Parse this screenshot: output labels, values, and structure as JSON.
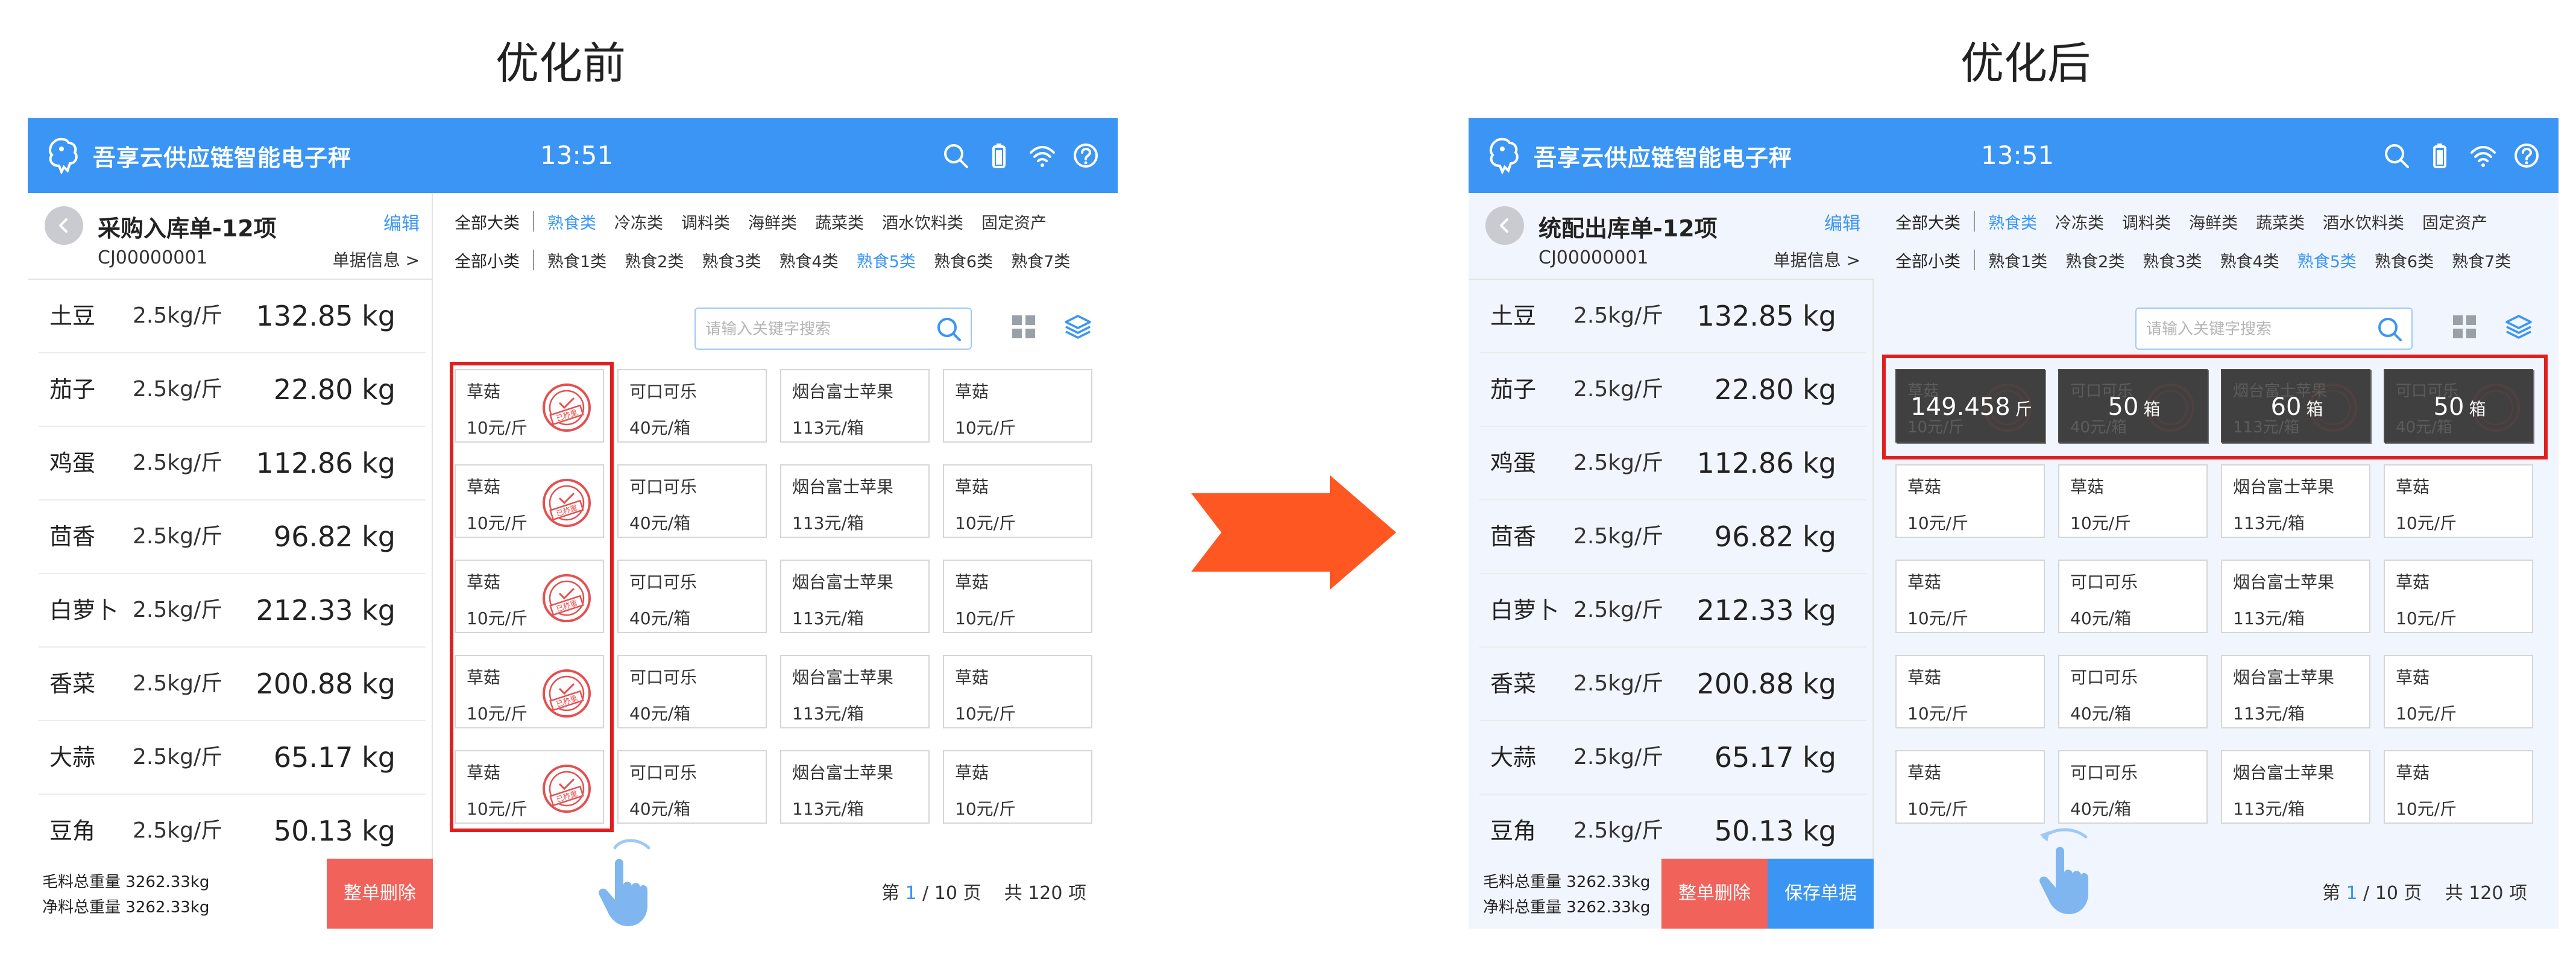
{
  "labels": {
    "before": "优化前",
    "after": "优化后"
  },
  "app": {
    "name": "吾享云供应链智能电子秤",
    "time": "13:51"
  },
  "colors": {
    "primary": "#3b95f4",
    "danger": "#f0625a",
    "highlight": "#e02020",
    "arrow": "#ff5722"
  },
  "icons": [
    "search-icon",
    "battery-icon",
    "wifi-icon",
    "help-icon",
    "back-icon",
    "grid-view-icon",
    "layers-icon",
    "stamp-icon",
    "hand-swipe-icon",
    "arrow-right-icon"
  ],
  "filters": {
    "major_label": "全部大类",
    "major": [
      "熟食类",
      "冷冻类",
      "调料类",
      "海鲜类",
      "蔬菜类",
      "酒水饮料类",
      "固定资产"
    ],
    "major_active": 0,
    "minor_label": "全部小类",
    "minor": [
      "熟食1类",
      "熟食2类",
      "熟食3类",
      "熟食4类",
      "熟食5类",
      "熟食6类",
      "熟食7类"
    ],
    "minor_active": 4
  },
  "search": {
    "placeholder": "请输入关键字搜索"
  },
  "items": [
    {
      "name": "土豆",
      "unit": "2.5kg/斤",
      "weight": "132.85 kg"
    },
    {
      "name": "茄子",
      "unit": "2.5kg/斤",
      "weight": "22.80 kg"
    },
    {
      "name": "鸡蛋",
      "unit": "2.5kg/斤",
      "weight": "112.86 kg"
    },
    {
      "name": "茴香",
      "unit": "2.5kg/斤",
      "weight": "96.82 kg"
    },
    {
      "name": "白萝卜",
      "unit": "2.5kg/斤",
      "weight": "212.33 kg"
    },
    {
      "name": "香菜",
      "unit": "2.5kg/斤",
      "weight": "200.88 kg"
    },
    {
      "name": "大蒜",
      "unit": "2.5kg/斤",
      "weight": "65.17 kg"
    },
    {
      "name": "豆角",
      "unit": "2.5kg/斤",
      "weight": "50.13 kg"
    }
  ],
  "products": [
    {
      "name": "草菇",
      "price": "10元/斤"
    },
    {
      "name": "可口可乐",
      "price": "40元/箱"
    },
    {
      "name": "烟台富士苹果",
      "price": "113元/箱"
    },
    {
      "name": "草菇",
      "price": "10元/斤"
    }
  ],
  "before": {
    "title": "采购入库单-12项",
    "edit": "编辑",
    "order_no": "CJ00000001",
    "info": "单据信息 >",
    "gross_label": "毛料总重量",
    "gross": "3262.33kg",
    "net_label": "净料总重量",
    "net": "3262.33kg",
    "delete": "整单删除",
    "stamp_text": "已称重",
    "pager": {
      "prefix": "第",
      "current": "1",
      "total_pages": "/ 10 页",
      "total_items": "共 120 项"
    }
  },
  "after": {
    "title": "统配出库单-12项",
    "edit": "编辑",
    "order_no": "CJ00000001",
    "info": "单据信息 >",
    "gross_label": "毛料总重量",
    "gross": "3262.33kg",
    "net_label": "净料总重量",
    "net": "3262.33kg",
    "delete": "整单删除",
    "save": "保存单据",
    "weighed": [
      {
        "value": "149.458",
        "unit": "斤"
      },
      {
        "value": "50",
        "unit": "箱"
      },
      {
        "value": "60",
        "unit": "箱"
      },
      {
        "value": "50",
        "unit": "箱"
      }
    ],
    "pager": {
      "prefix": "第",
      "current": "1",
      "total_pages": "/ 10 页",
      "total_items": "共 120 项"
    }
  }
}
